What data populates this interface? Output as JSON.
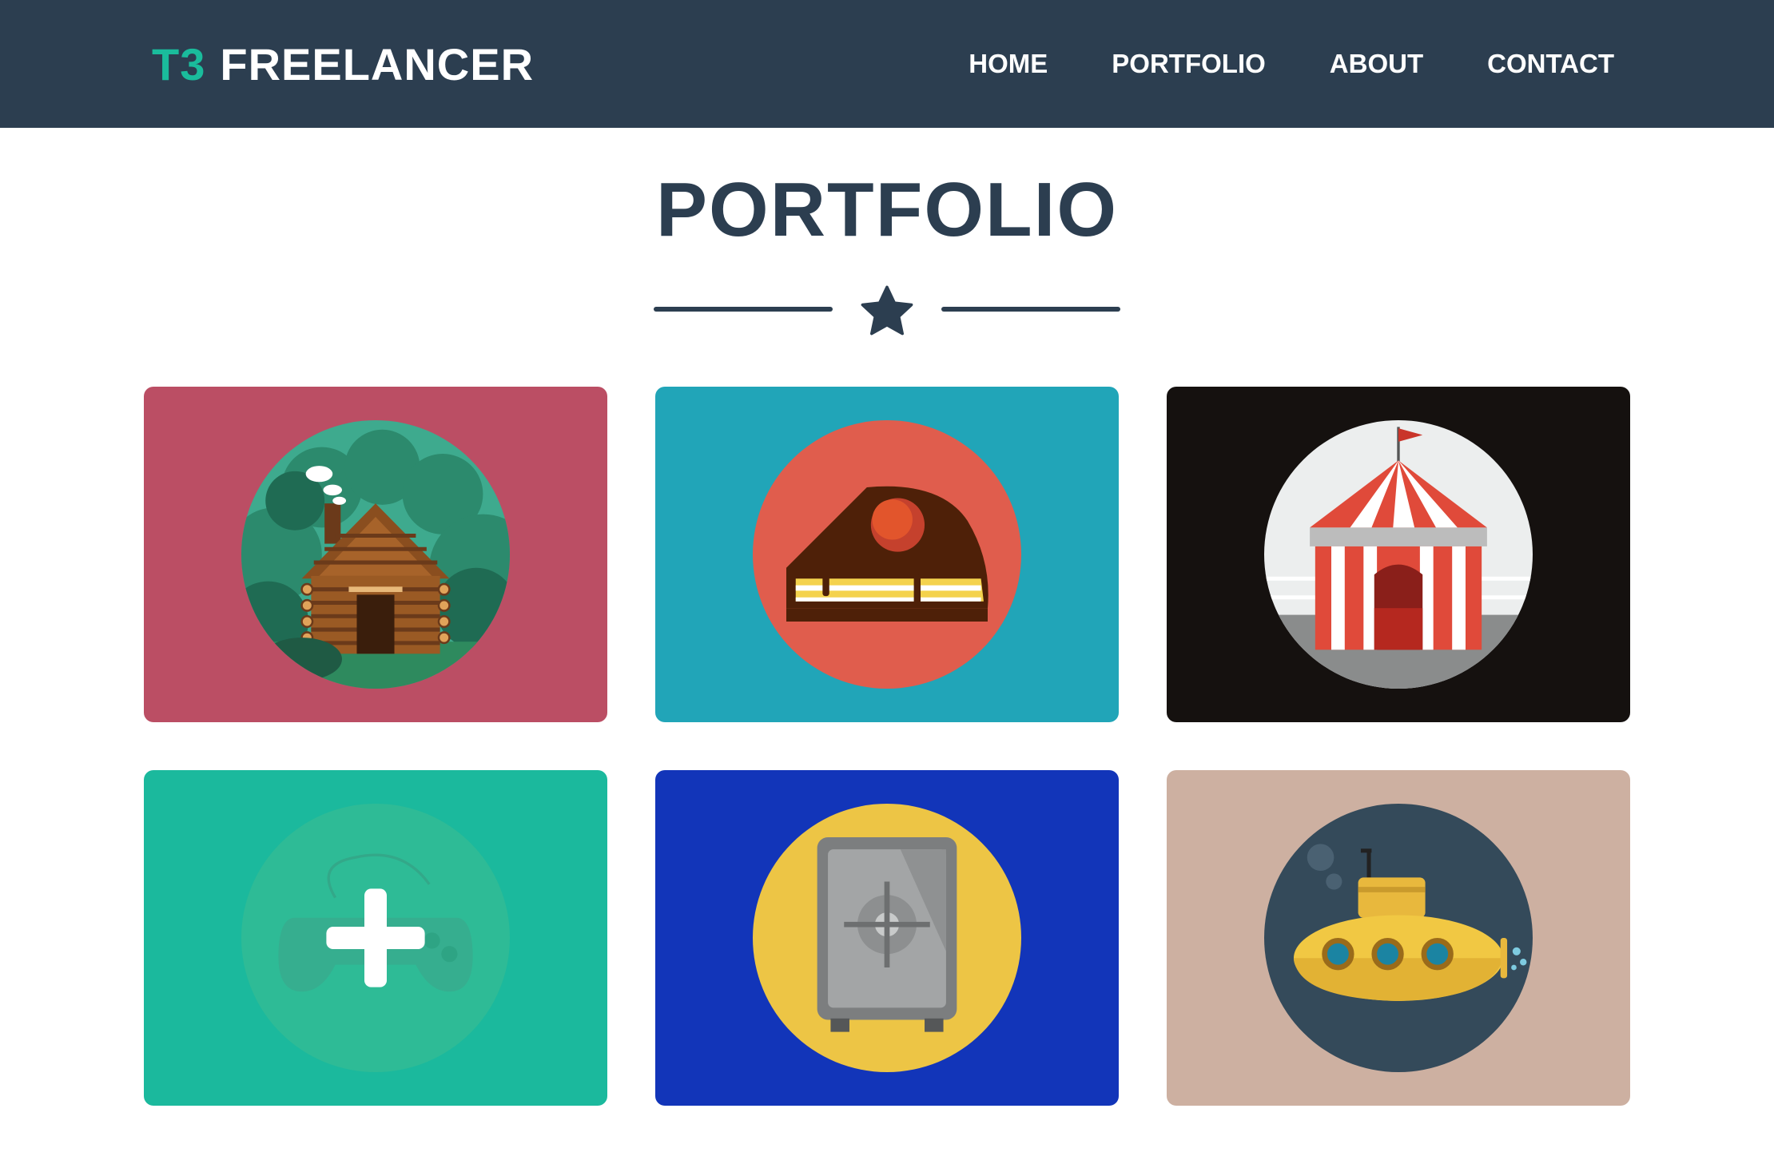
{
  "nav": {
    "brand_accent": "T3",
    "brand_main": "FREELANCER",
    "links": [
      "HOME",
      "PORTFOLIO",
      "ABOUT",
      "CONTACT"
    ]
  },
  "section": {
    "title": "PORTFOLIO"
  },
  "colors": {
    "navbar": "#2c3e50",
    "accent": "#1abc9c",
    "title": "#2c3e50"
  },
  "portfolio": {
    "items": [
      {
        "icon": "log-cabin-icon",
        "background": "#bb4e64"
      },
      {
        "icon": "cake-slice-icon",
        "background": "#21a5b8"
      },
      {
        "icon": "circus-tent-icon",
        "background": "#15110f"
      },
      {
        "icon": "game-controller-icon",
        "background": "#1bb99d",
        "overlay_icon": "plus-icon"
      },
      {
        "icon": "safe-icon",
        "background": "#1235b9"
      },
      {
        "icon": "submarine-icon",
        "background": "#cdb0a1"
      }
    ]
  }
}
